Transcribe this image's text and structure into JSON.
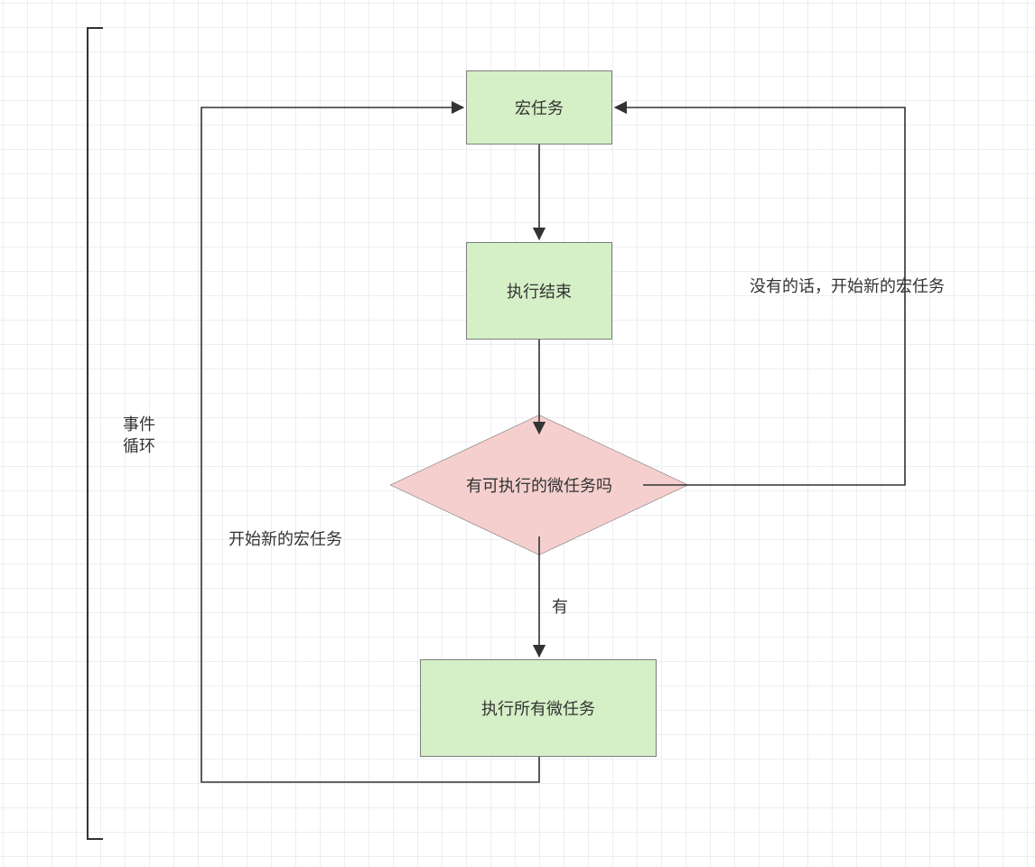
{
  "chart_data": {
    "type": "flowchart",
    "title": "事件循环",
    "nodes": [
      {
        "id": "macro",
        "kind": "process",
        "label": "宏任务"
      },
      {
        "id": "done",
        "kind": "process",
        "label": "执行结束"
      },
      {
        "id": "hasMicro",
        "kind": "decision",
        "label": "有可执行的微任务吗"
      },
      {
        "id": "runMicro",
        "kind": "process",
        "label": "执行所有微任务"
      }
    ],
    "edges": [
      {
        "from": "macro",
        "to": "done"
      },
      {
        "from": "done",
        "to": "hasMicro"
      },
      {
        "from": "hasMicro",
        "to": "runMicro",
        "label": "有"
      },
      {
        "from": "hasMicro",
        "to": "macro",
        "label": "没有的话，开始新的宏任务"
      },
      {
        "from": "runMicro",
        "to": "macro",
        "label": "开始新的宏任务"
      }
    ],
    "bracket_label": "事件\n循环"
  },
  "nodes": {
    "macro": "宏任务",
    "done": "执行结束",
    "hasMicro": "有可执行的微任务吗",
    "runMicro": "执行所有微任务"
  },
  "edges": {
    "yes": "有",
    "noNewMacro": "没有的话，开始新的宏任务",
    "startNewMacro": "开始新的宏任务"
  },
  "labels": {
    "eventLoop": "事件\n循环"
  },
  "colors": {
    "process": "#d5efc6",
    "decision": "#f4cfce",
    "stroke": "#333333",
    "grid": "#dce1e8"
  }
}
